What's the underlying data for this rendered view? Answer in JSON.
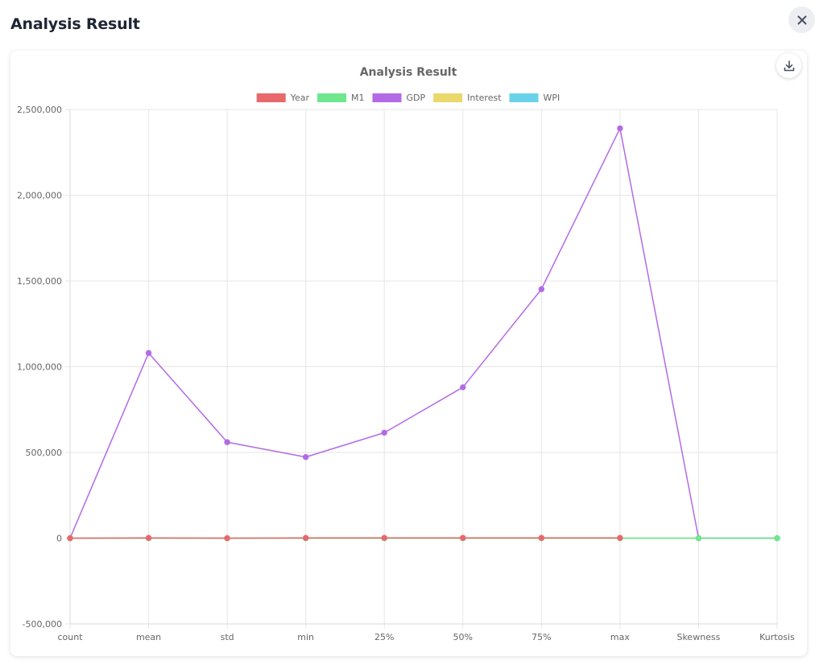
{
  "dialog": {
    "title": "Analysis Result"
  },
  "icons": {
    "close": "close-icon",
    "download": "download-icon"
  },
  "chart_data": {
    "type": "line",
    "title": "Analysis Result",
    "categories": [
      "count",
      "mean",
      "std",
      "min",
      "25%",
      "50%",
      "75%",
      "max",
      "Skewness",
      "Kurtosis"
    ],
    "ylim": [
      -500000,
      2500000
    ],
    "yticks": [
      -500000,
      0,
      500000,
      1000000,
      1500000,
      2000000,
      2500000
    ],
    "ytick_labels": [
      "-500,000",
      "0",
      "500,000",
      "1,000,000",
      "1,500,000",
      "2,000,000",
      "2,500,000"
    ],
    "grid": true,
    "legend_position": "top",
    "series": [
      {
        "name": "Year",
        "color": "#e8686b",
        "values": [
          0,
          2000,
          0,
          1990,
          1995,
          2000,
          2005,
          2010,
          null,
          null
        ]
      },
      {
        "name": "M1",
        "color": "#6ee78f",
        "values": [
          0,
          0,
          0,
          0,
          0,
          0,
          0,
          0,
          0,
          0
        ]
      },
      {
        "name": "GDP",
        "color": "#b36ae6",
        "values": [
          0,
          1080000,
          560000,
          473000,
          615000,
          880000,
          1452000,
          2390000,
          0,
          0
        ]
      },
      {
        "name": "Interest",
        "color": "#ead86b",
        "values": [
          0,
          0,
          0,
          0,
          0,
          0,
          0,
          0,
          0,
          0
        ]
      },
      {
        "name": "WPI",
        "color": "#69d2e8",
        "values": [
          0,
          0,
          0,
          0,
          0,
          0,
          0,
          0,
          0,
          0
        ]
      }
    ]
  }
}
